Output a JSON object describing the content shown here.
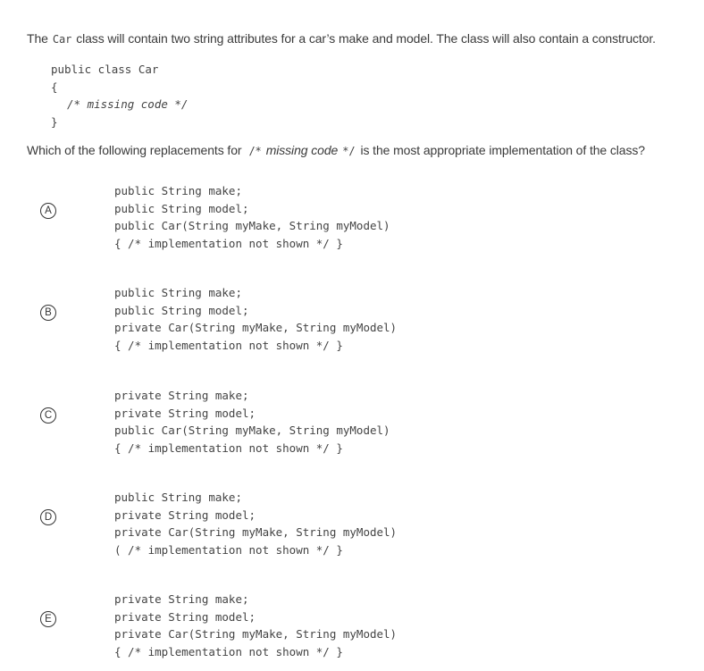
{
  "intro": {
    "prefix": "The",
    "code_term": "Car",
    "suffix": "class will contain two string attributes for a car’s make and model. The class will also contain a constructor."
  },
  "stem_code": {
    "line1": "public class Car",
    "line2": "{",
    "line3": "/* missing code */",
    "line4": "}"
  },
  "question": {
    "prefix": "Which of the following replacements for",
    "code_open": "/*",
    "code_italic": "missing code",
    "code_close": "*/",
    "suffix": "is the most appropriate implementation of the class?"
  },
  "choices": [
    {
      "letter": "A",
      "lines": [
        "public String make;",
        "public String model;",
        "public Car(String myMake, String myModel)",
        "{ /* implementation not shown */ }"
      ]
    },
    {
      "letter": "B",
      "lines": [
        "public String make;",
        "public String model;",
        "private Car(String myMake, String myModel)",
        "{ /* implementation not shown */ }"
      ]
    },
    {
      "letter": "C",
      "lines": [
        "private String make;",
        "private String model;",
        "public Car(String myMake, String myModel)",
        "{ /* implementation not shown */ }"
      ]
    },
    {
      "letter": "D",
      "lines": [
        "public String make;",
        "private String model;",
        "private Car(String myMake, String myModel)",
        "( /* implementation not shown */ }"
      ]
    },
    {
      "letter": "E",
      "lines": [
        "private String make;",
        "private String model;",
        "private Car(String myMake, String myModel)",
        "{ /* implementation not shown */ }"
      ]
    }
  ]
}
